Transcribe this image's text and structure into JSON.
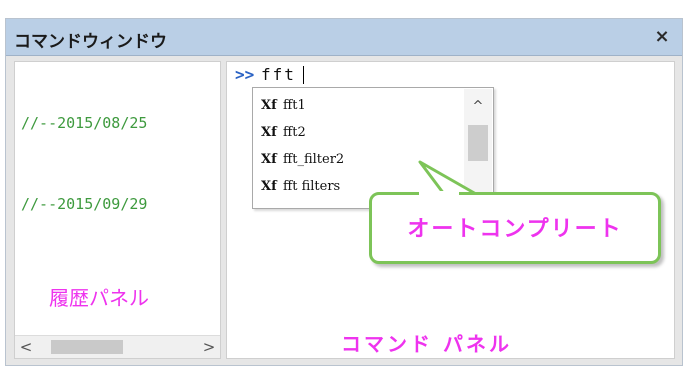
{
  "window": {
    "title": "コマンドウィンドウ",
    "close_glyph": "×"
  },
  "history": {
    "entries": [
      "//--2015/08/25",
      "//--2015/09/29"
    ],
    "panel_label": "履歴パネル",
    "scroll_left": "<",
    "scroll_right": ">"
  },
  "command": {
    "prompt": ">>",
    "input_value": "fft",
    "panel_label": "コマンド パネル"
  },
  "autocomplete": {
    "icon_glyph": "Xf",
    "items": [
      "fft1",
      "fft2",
      "fft_filter2",
      "fft filters"
    ],
    "scroll_up": "^",
    "callout_text": "オートコンプリート"
  },
  "colors": {
    "titlebar": "#bacfe6",
    "history_text": "#3e9a3e",
    "label_magenta": "#ee33ee",
    "prompt_blue": "#2a62c4",
    "callout_border": "#7dc458"
  }
}
